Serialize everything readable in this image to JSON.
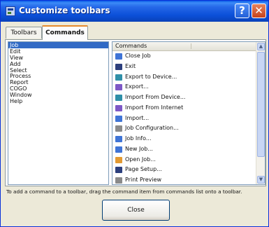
{
  "window": {
    "title": "Customize toolbars",
    "help_glyph": "?",
    "close_glyph": "✕"
  },
  "tabs": [
    {
      "label": "Toolbars",
      "active": false
    },
    {
      "label": "Commands",
      "active": true
    }
  ],
  "categories": [
    {
      "label": "Job",
      "selected": true
    },
    {
      "label": "Edit",
      "selected": false
    },
    {
      "label": "View",
      "selected": false
    },
    {
      "label": "Add",
      "selected": false
    },
    {
      "label": "Select",
      "selected": false
    },
    {
      "label": "Process",
      "selected": false
    },
    {
      "label": "Report",
      "selected": false
    },
    {
      "label": "COGO",
      "selected": false
    },
    {
      "label": "Window",
      "selected": false
    },
    {
      "label": "Help",
      "selected": false
    }
  ],
  "commands": {
    "header": "Commands",
    "items": [
      {
        "label": "Close Job",
        "icon": "close-job-icon",
        "color": "blue"
      },
      {
        "label": "Exit",
        "icon": "exit-icon",
        "color": "dark"
      },
      {
        "label": "Export to Device...",
        "icon": "export-device-icon",
        "color": "teal"
      },
      {
        "label": "Export...",
        "icon": "export-icon",
        "color": "purple"
      },
      {
        "label": "Import From Device...",
        "icon": "import-device-icon",
        "color": "teal"
      },
      {
        "label": "Import From Internet",
        "icon": "import-internet-icon",
        "color": "purple"
      },
      {
        "label": "Import...",
        "icon": "import-icon",
        "color": "blue"
      },
      {
        "label": "Job Configuration...",
        "icon": "job-config-icon",
        "color": "gray"
      },
      {
        "label": "Job Info...",
        "icon": "job-info-icon",
        "color": "blue"
      },
      {
        "label": "New Job...",
        "icon": "new-job-icon",
        "color": "blue"
      },
      {
        "label": "Open Job...",
        "icon": "open-job-icon",
        "color": "orange"
      },
      {
        "label": "Page Setup...",
        "icon": "page-setup-icon",
        "color": "dark"
      },
      {
        "label": "Print Preview",
        "icon": "print-preview-icon",
        "color": "gray"
      }
    ]
  },
  "hint": "To add a command to a toolbar, drag the command item from commands list onto a toolbar.",
  "close_button": "Close"
}
